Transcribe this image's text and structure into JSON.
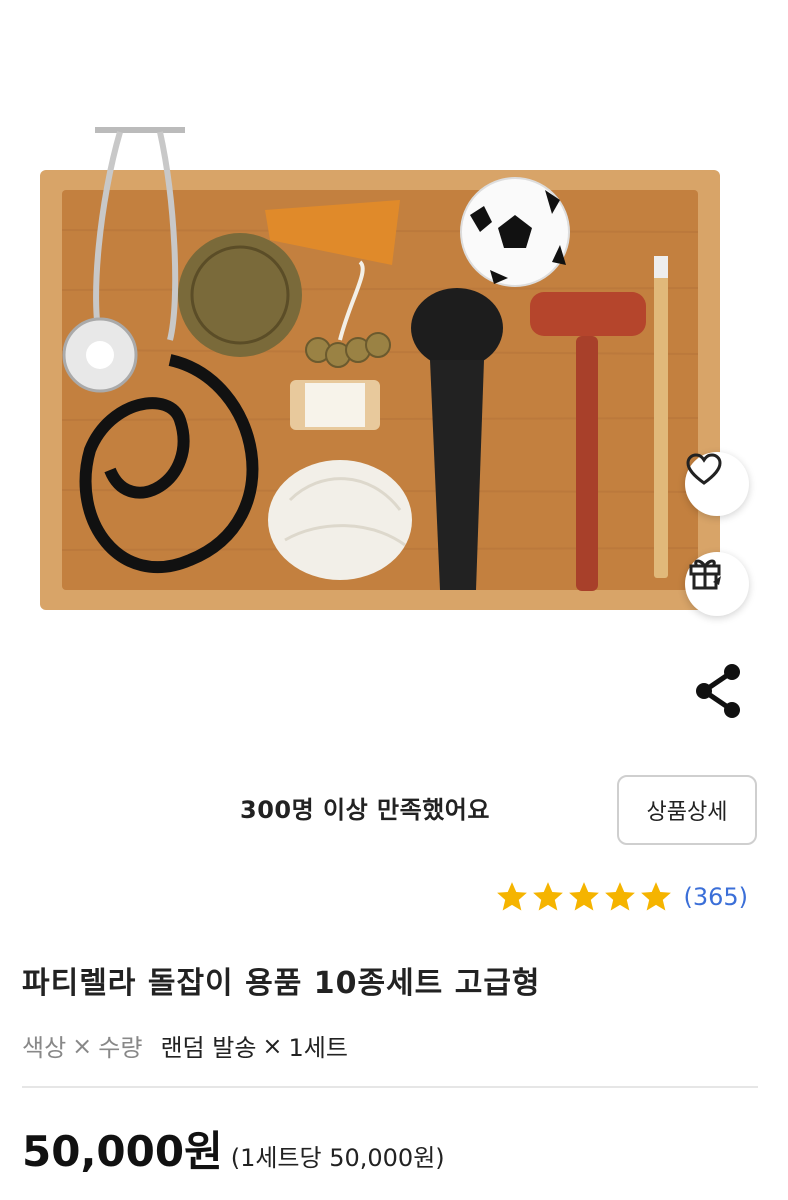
{
  "product": {
    "satisfied_text": "300명 이상 만족했어요",
    "detail_button": "상품상세",
    "rating_count": "(365)",
    "stars": 5,
    "title": "파티렐라 돌잡이 용품 10종세트 고급형",
    "options": {
      "color_label": "색상",
      "quantity_label": "수량",
      "x": "×",
      "color_value": "랜덤 발송",
      "quantity_value": "1세트"
    },
    "price": "50,000원",
    "unit_price": "(1세트당 50,000원)"
  },
  "icons": {
    "like": "heart-icon",
    "gift": "gift-icon",
    "share": "share-icon",
    "star": "star-icon"
  },
  "colors": {
    "star": "#f5b400",
    "count": "#3b6fd8",
    "tray": "#c98a4a"
  }
}
